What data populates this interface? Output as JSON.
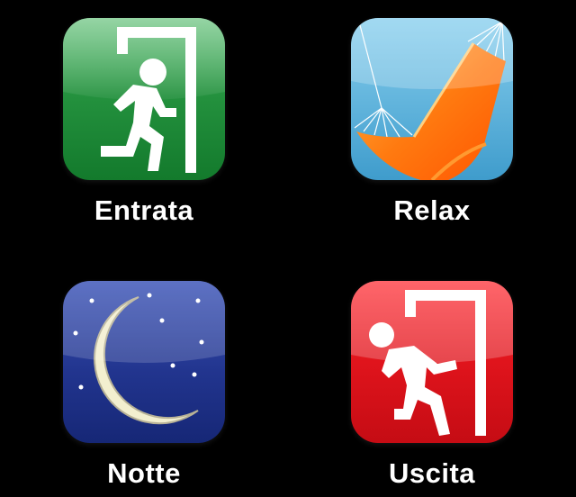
{
  "app": {
    "tiles": [
      {
        "id": "entrata",
        "label": "Entrata",
        "icon": "enter-door-icon",
        "color": "#1e8a3a"
      },
      {
        "id": "relax",
        "label": "Relax",
        "icon": "hammock-icon",
        "color": "#5cb6dc"
      },
      {
        "id": "notte",
        "label": "Notte",
        "icon": "moon-icon",
        "color": "#1c2f86"
      },
      {
        "id": "uscita",
        "label": "Uscita",
        "icon": "exit-door-icon",
        "color": "#d8101a"
      }
    ]
  }
}
